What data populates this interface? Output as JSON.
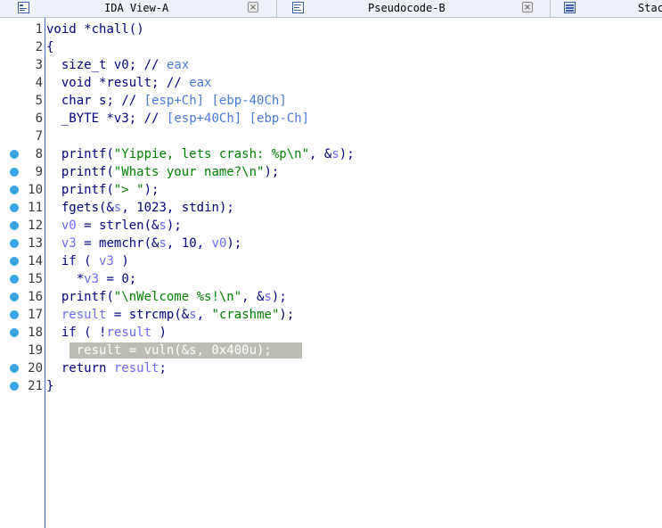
{
  "tabs": [
    {
      "label": "IDA View-A",
      "icon": "ida-view-icon",
      "close": "×"
    },
    {
      "label": "Pseudocode-B",
      "icon": "pseudocode-icon",
      "close": "×"
    },
    {
      "label": "Stac",
      "icon": "stack-view-icon"
    }
  ],
  "code": {
    "lines": [
      {
        "n": "1",
        "bp": false,
        "text": "void *chall()"
      },
      {
        "n": "2",
        "bp": false,
        "text": "{"
      },
      {
        "n": "3",
        "bp": false,
        "text": "  size_t v0; // eax"
      },
      {
        "n": "4",
        "bp": false,
        "text": "  void *result; // eax"
      },
      {
        "n": "5",
        "bp": false,
        "text": "  char s; // [esp+Ch] [ebp-40Ch]"
      },
      {
        "n": "6",
        "bp": false,
        "text": "  _BYTE *v3; // [esp+40Ch] [ebp-Ch]"
      },
      {
        "n": "7",
        "bp": false,
        "text": ""
      },
      {
        "n": "8",
        "bp": true,
        "text": "  printf(\"Yippie, lets crash: %p\\n\", &s);"
      },
      {
        "n": "9",
        "bp": true,
        "text": "  printf(\"Whats your name?\\n\");"
      },
      {
        "n": "10",
        "bp": true,
        "text": "  printf(\"> \");"
      },
      {
        "n": "11",
        "bp": true,
        "text": "  fgets(&s, 1023, stdin);"
      },
      {
        "n": "12",
        "bp": true,
        "text": "  v0 = strlen(&s);"
      },
      {
        "n": "13",
        "bp": true,
        "text": "  v3 = memchr(&s, 10, v0);"
      },
      {
        "n": "14",
        "bp": true,
        "text": "  if ( v3 )"
      },
      {
        "n": "15",
        "bp": true,
        "text": "    *v3 = 0;"
      },
      {
        "n": "16",
        "bp": true,
        "text": "  printf(\"\\nWelcome %s!\\n\", &s);"
      },
      {
        "n": "17",
        "bp": true,
        "text": "  result = strcmp(&s, \"crashme\");"
      },
      {
        "n": "18",
        "bp": true,
        "text": "  if ( !result )"
      },
      {
        "n": "19",
        "bp": false,
        "text": "    result = vuln(&s, 0x400u);",
        "highlighted": true
      },
      {
        "n": "20",
        "bp": true,
        "text": "  return result;"
      },
      {
        "n": "21",
        "bp": true,
        "text": "}"
      }
    ]
  },
  "colors": {
    "identifier": "#000080",
    "variable": "#6a6af5",
    "comment": "#4a7ad8",
    "string": "#008000",
    "breakpoint": "#3aa3e3",
    "highlight": "#bdbdb5"
  }
}
